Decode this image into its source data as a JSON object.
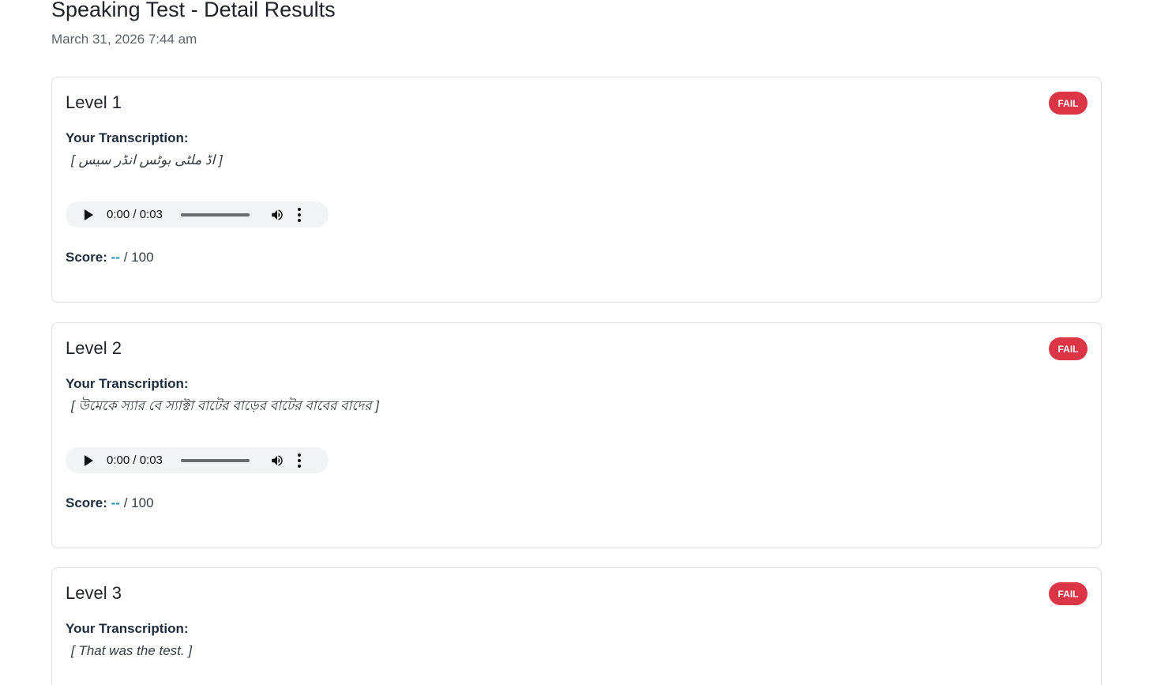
{
  "header": {
    "title": "Speaking Test - Detail Results",
    "date": "March 31, 2026 7:44 am"
  },
  "levels": [
    {
      "title": "Level 1",
      "status": "FAIL",
      "transcription_label": "Your Transcription:",
      "transcription": "[ اڈ ملٹی بوٹس انڈر سیس ]",
      "audio_time": "0:00 / 0:03",
      "score_label": "Score:",
      "score_value": "--",
      "score_max": "/ 100"
    },
    {
      "title": "Level 2",
      "status": "FAIL",
      "transcription_label": "Your Transcription:",
      "transcription": "[ উমেকে স্যার বে স্যাক্টা বাটের বাড়ের বাটের বাবের বাদের ]",
      "audio_time": "0:00 / 0:03",
      "score_label": "Score:",
      "score_value": "--",
      "score_max": "/ 100"
    },
    {
      "title": "Level 3",
      "status": "FAIL",
      "transcription_label": "Your Transcription:",
      "transcription": "[ That was the test. ]"
    }
  ],
  "colors": {
    "fail_badge": "#dc3545",
    "score_value": "#1f8fb8",
    "audio_bg": "#f1f3f4"
  },
  "icons": {
    "play": "play-icon",
    "volume": "volume-icon",
    "more": "more-vertical-icon"
  }
}
